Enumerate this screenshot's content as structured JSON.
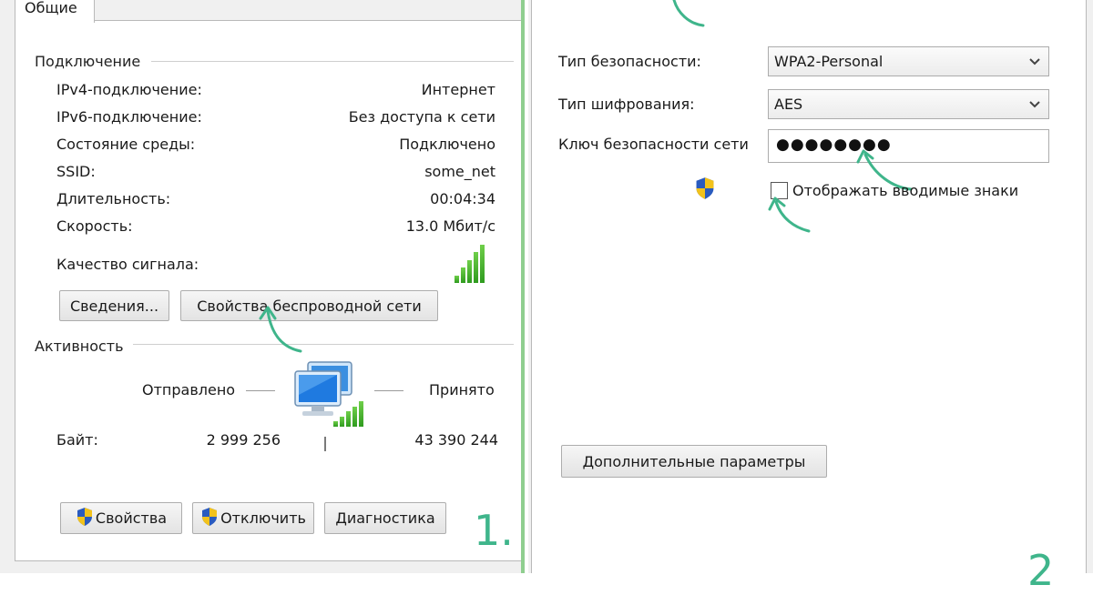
{
  "window": {
    "tabs": [
      {
        "label": "Общие"
      }
    ]
  },
  "connection": {
    "section_title": "Подключение",
    "rows": [
      {
        "label": "IPv4-подключение:",
        "value": "Интернет"
      },
      {
        "label": "IPv6-подключение:",
        "value": "Без доступа к сети"
      },
      {
        "label": "Состояние среды:",
        "value": "Подключено"
      },
      {
        "label": "SSID:",
        "value": "some_net"
      },
      {
        "label": "Длительность:",
        "value": "00:04:34"
      },
      {
        "label": "Скорость:",
        "value": "13.0 Мбит/с"
      }
    ],
    "signal_label": "Качество сигнала:",
    "signal_bars_active": 5,
    "signal_bars_total": 5,
    "details_button": "Сведения...",
    "wireless_props_button": "Свойства беспроводной сети"
  },
  "activity": {
    "section_title": "Активность",
    "sent_label": "Отправлено",
    "received_label": "Принято",
    "bytes_label": "Байт:",
    "bytes_sent": "2 999 256",
    "bytes_received": "43 390 244"
  },
  "footer": {
    "properties_button": "Свойства",
    "disconnect_button": "Отключить",
    "diagnostics_button": "Диагностика"
  },
  "security": {
    "security_type_label": "Тип безопасности:",
    "security_type_value": "WPA2-Personal",
    "encryption_type_label": "Тип шифрования:",
    "encryption_type_value": "AES",
    "network_key_label": "Ключ безопасности сети",
    "network_key_masked": "●●●●●●●●",
    "show_chars_label": "Отображать вводимые знаки",
    "show_chars_checked": false,
    "advanced_button": "Дополнительные параметры"
  },
  "annotations": {
    "step_left": "1.",
    "step_right": "2"
  },
  "colors": {
    "annotation_arrow": "#3fb58b",
    "panel_accent": "#8fce8f",
    "signal_green": "#3aa82a",
    "shield_blue": "#2a5bbf",
    "shield_yellow": "#f2c21b"
  },
  "icons": {
    "network": "network-computers-icon",
    "shield": "uac-shield-icon",
    "chevron": "chevron-down-icon",
    "arrow": "annotation-arrow-icon"
  }
}
